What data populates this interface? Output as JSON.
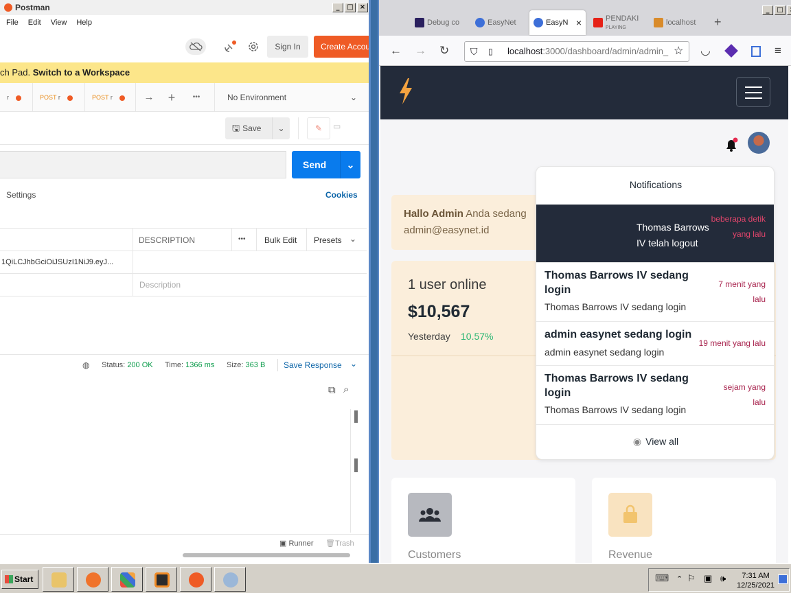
{
  "postman": {
    "title": "Postman",
    "menu": [
      "File",
      "Edit",
      "View",
      "Help"
    ],
    "signin": "Sign In",
    "create_account": "Create Account",
    "banner_prefix": "ch Pad.",
    "banner_link": "Switch to a Workspace",
    "tab_method": "POST",
    "tab_mark": "r",
    "environment": "No Environment",
    "save": "Save",
    "send": "Send",
    "settings": "Settings",
    "cookies": "Cookies",
    "headers": {
      "description": "DESCRIPTION",
      "more": "•••",
      "bulk_edit": "Bulk Edit",
      "presets": "Presets",
      "token_value": "1QiLCJhbGciOiJSUzI1NiJ9.eyJ...",
      "description_placeholder": "Description"
    },
    "status": {
      "status_label": "Status:",
      "status_value": "200 OK",
      "time_label": "Time:",
      "time_value": "1366 ms",
      "size_label": "Size:",
      "size_value": "363 B",
      "save_response": "Save Response"
    },
    "footer": {
      "runner": "Runner",
      "trash": "Trash"
    }
  },
  "firefox": {
    "tabs": [
      {
        "label": "Debug co",
        "color": "#2a1f5e"
      },
      {
        "label": "EasyNet",
        "color": "#3d6fd8"
      },
      {
        "label": "EasyN",
        "color": "#3d6fd8"
      },
      {
        "label": "PENDAKI",
        "sub": "PLAYING",
        "color": "#e62117"
      },
      {
        "label": "localhost",
        "color": "#d98b2a"
      }
    ],
    "url_main": "localhost",
    "url_rest": ":3000/dashboard/admin/admin_"
  },
  "dashboard": {
    "greeting_bold": "Hallo Admin",
    "greeting_rest": "Anda sedang",
    "greeting_email": "admin@easynet.id",
    "online": "1 user online",
    "amount": "$10,567",
    "yesterday_label": "Yesterday",
    "yesterday_change": "10.57%",
    "notifications_title": "Notifications",
    "notifications": [
      {
        "title": "Thomas Barrows IV telah logout",
        "subtitle": "",
        "time": "beberapa detik yang lalu"
      },
      {
        "title": "Thomas Barrows IV sedang login",
        "subtitle": "Thomas Barrows IV sedang login",
        "time": "7 menit yang lalu"
      },
      {
        "title": "admin easynet sedang login",
        "subtitle": "admin easynet sedang login",
        "time": "19 menit yang lalu"
      },
      {
        "title": "Thomas Barrows IV sedang login",
        "subtitle": "Thomas Barrows IV sedang login",
        "time": "sejam yang lalu"
      }
    ],
    "view_all": "View all",
    "cards": [
      {
        "label": "Customers",
        "color": "#b7b9bf"
      },
      {
        "label": "Revenue",
        "color": "#f9e3c0"
      }
    ]
  },
  "taskbar": {
    "start": "Start",
    "time": "7:31 AM",
    "date": "12/25/2021"
  }
}
